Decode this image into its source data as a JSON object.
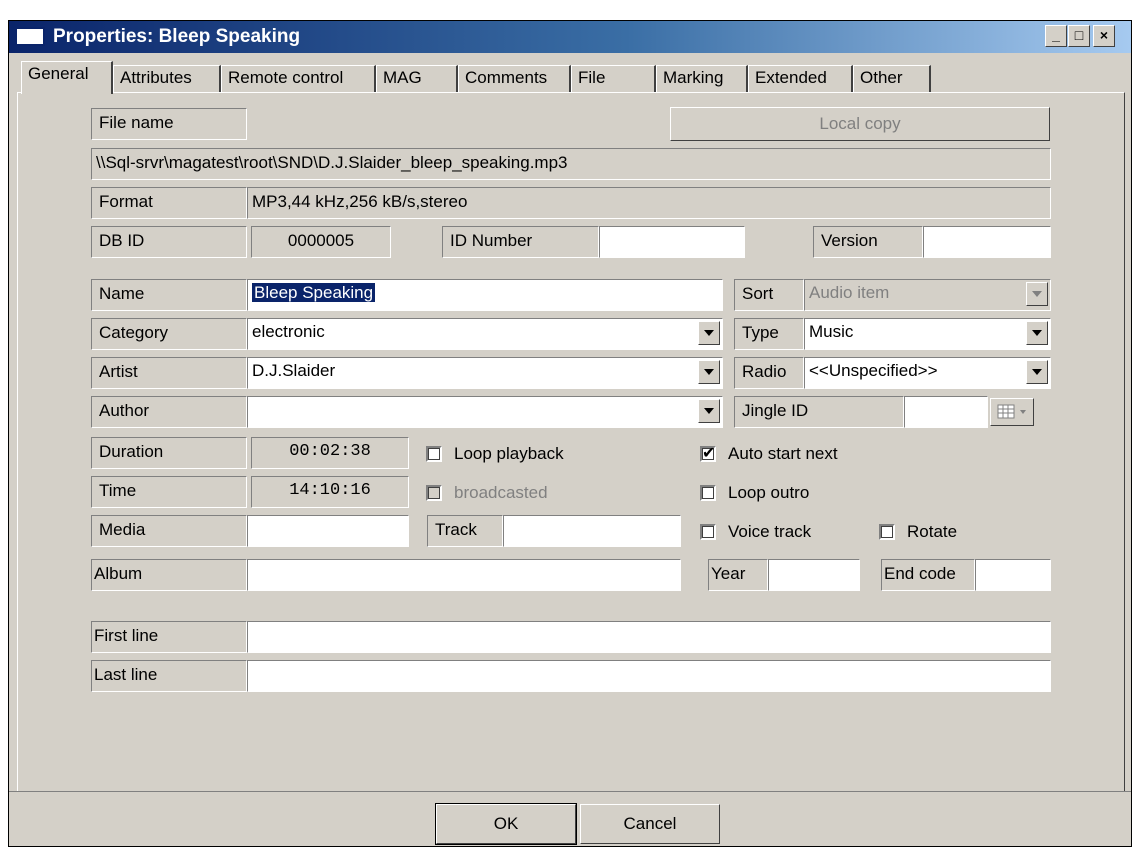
{
  "window": {
    "title": "Properties: Bleep Speaking"
  },
  "tabs": [
    "General",
    "Attributes",
    "Remote control",
    "MAG",
    "Comments",
    "File",
    "Marking",
    "Extended",
    "Other"
  ],
  "file": {
    "label": "File name",
    "local_copy": "Local copy",
    "path": "\\\\Sql-srvr\\magatest\\root\\SND\\D.J.Slaider_bleep_speaking.mp3",
    "format_label": "Format",
    "format": "MP3,44 kHz,256 kB/s,stereo",
    "dbid_label": "DB ID",
    "dbid": "0000005",
    "idnumber_label": "ID Number",
    "idnumber": "",
    "version_label": "Version",
    "version": ""
  },
  "meta": {
    "name_label": "Name",
    "name": "Bleep Speaking",
    "category_label": "Category",
    "category": "electronic",
    "artist_label": "Artist",
    "artist": "D.J.Slaider",
    "author_label": "Author",
    "author": "",
    "sort_label": "Sort",
    "sort": "Audio item",
    "type_label": "Type",
    "type": "Music",
    "radio_label": "Radio",
    "radio": "<<Unspecified>>",
    "jingle_label": "Jingle ID",
    "jingle": ""
  },
  "timing": {
    "duration_label": "Duration",
    "duration": "00:02:38",
    "time_label": "Time",
    "time": "14:10:16",
    "media_label": "Media",
    "media": "",
    "track_label": "Track",
    "track": ""
  },
  "options": {
    "loop_playback": "Loop playback",
    "broadcasted": "broadcasted",
    "auto_start_next": "Auto start next",
    "loop_outro": "Loop outro",
    "voice_track": "Voice track",
    "rotate": "Rotate"
  },
  "album": {
    "album_label": "Album",
    "album": "",
    "year_label": "Year",
    "year": "",
    "endcode_label": "End code",
    "endcode": ""
  },
  "lines": {
    "first_label": "First line",
    "first": "",
    "last_label": "Last line",
    "last": ""
  },
  "buttons": {
    "ok": "OK",
    "cancel": "Cancel"
  }
}
